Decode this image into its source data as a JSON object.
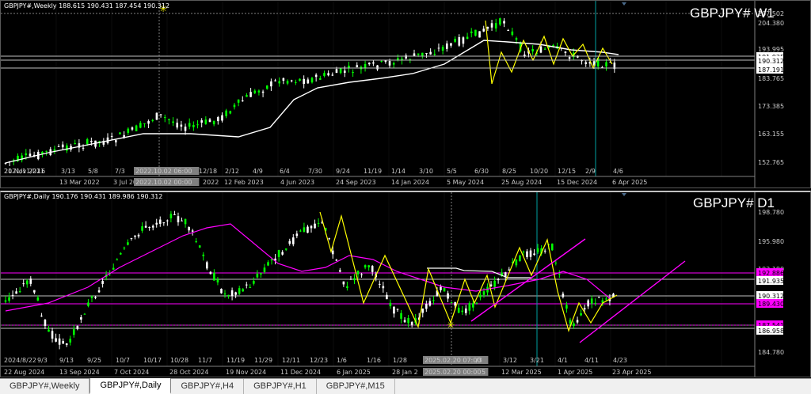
{
  "weekly": {
    "header": "GBPJPY#,Weekly  188.615 190.431 187.454 190.312",
    "big_title": "GBPJPY# W1",
    "price_labels": [
      "207.502",
      "204.380",
      "193.995",
      "191.935",
      "190.312",
      "187.191",
      "183.765",
      "173.385",
      "163.155",
      "152.765"
    ],
    "time_labels": [
      "21 Nov 2021",
      "2021/11/21",
      "16",
      "3/13",
      "5/8",
      "7/3",
      "2022.10.02 06:00",
      "12/18",
      "2/12",
      "4/9",
      "6/4",
      "7/30",
      "9/24",
      "11/19",
      "1/14",
      "3/10",
      "5/5",
      "6/30",
      "8/25",
      "10/20",
      "12/15",
      "2/9",
      "4/6"
    ],
    "date_labels": [
      "13 Mar 2022",
      "3 Jul 2022",
      "2022.10.02 00:00",
      "2022",
      "12 Feb 2023",
      "4 Jun 2023",
      "24 Sep 2023",
      "14 Jan 2024",
      "5 May 2024",
      "25 Aug 2024",
      "15 Dec 2024",
      "6 Apr 2025"
    ]
  },
  "daily": {
    "header": "GBPJPY#,Daily  190.176 190.431 189.986 190.312",
    "big_title": "GBPJPY# D1",
    "price_labels": [
      "198.780",
      "195.980",
      "193.180",
      "192.886",
      "191.935",
      "190.312",
      "189.430",
      "187.541",
      "186.958",
      "184.780"
    ],
    "time_labels": [
      "2024/8/22",
      "9/3",
      "9/13",
      "9/25",
      "10/7",
      "10/17",
      "10/28",
      "11/7",
      "11/19",
      "11/29",
      "12/11",
      "12/23",
      "1/6",
      "1/16",
      "1/28",
      "2025.02.20 07:00",
      "/3",
      "3/12",
      "3/21",
      "4/1",
      "4/11",
      "4/23"
    ],
    "date_labels": [
      "22 Aug 2024",
      "13 Sep 2024",
      "7 Oct 2024",
      "28 Oct 2024",
      "19 Nov 2024",
      "11 Dec 2024",
      "6 Jan 2025",
      "28 Jan 2",
      "2025.02.20 00:00",
      "5",
      "12 Mar 2025",
      "1 Apr 2025",
      "23 Apr 2025"
    ]
  },
  "tabs": [
    "GBPJPY#,Weekly",
    "GBPJPY#,Daily",
    "GBPJPY#,H4",
    "GBPJPY#,H1",
    "GBPJPY#,M15"
  ],
  "active_tab": "GBPJPY#,Daily",
  "colors": {
    "bull": "#00ff00",
    "bear": "#ffffff",
    "ma_weekly": "#ffffff",
    "ma_daily": "#ff00ff",
    "zigzag": "#ffff00",
    "trend": "#ff00ff",
    "cursor": "#00c8c8",
    "highlight": "#ff00ff"
  }
}
